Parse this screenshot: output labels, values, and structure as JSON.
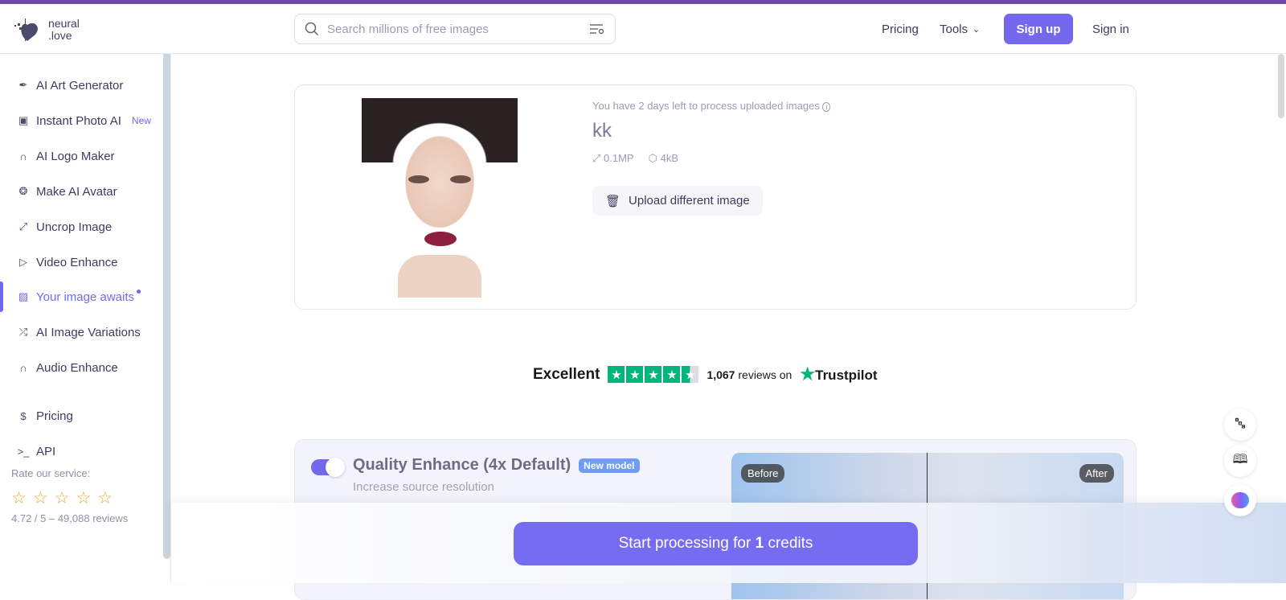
{
  "header": {
    "logo_line1": "neural",
    "logo_line2": ".love",
    "search_placeholder": "Search millions of free images",
    "nav_pricing": "Pricing",
    "nav_tools": "Tools",
    "signup": "Sign up",
    "signin": "Sign in"
  },
  "sidebar": {
    "items": [
      {
        "label": "AI Art Generator",
        "icon": "feather-icon"
      },
      {
        "label": "Instant Photo AI",
        "icon": "camera-icon",
        "badge": "New"
      },
      {
        "label": "AI Logo Maker",
        "icon": "rainbow-icon"
      },
      {
        "label": "Make AI Avatar",
        "icon": "aperture-icon"
      },
      {
        "label": "Uncrop Image",
        "icon": "expand-icon"
      },
      {
        "label": "Video Enhance",
        "icon": "play-icon"
      },
      {
        "label": "Your image awaits",
        "icon": "image-icon",
        "active": true
      },
      {
        "label": "AI Image Variations",
        "icon": "shuffle-icon"
      },
      {
        "label": "Audio Enhance",
        "icon": "headphones-icon"
      },
      {
        "label": "Pricing",
        "icon": "dollar-icon"
      },
      {
        "label": "API",
        "icon": "terminal-icon"
      }
    ],
    "rate_label": "Rate our service:",
    "rating_summary": "4.72 / 5 – 49,088 reviews"
  },
  "upload_card": {
    "notice": "You have 2 days left to process uploaded images",
    "file_name": "kk",
    "resolution": "0.1MP",
    "size": "4kB",
    "upload_button": "Upload different image"
  },
  "trustpilot": {
    "rating_word": "Excellent",
    "stars": 4.5,
    "review_count": "1,067",
    "reviews_on": "reviews on",
    "brand": "Trustpilot",
    "color": "#00b67a"
  },
  "enhance": {
    "title": "Quality Enhance (4x Default)",
    "badge": "New model",
    "subtitle": "Increase source resolution",
    "enabled": true,
    "before": "Before",
    "after": "After"
  },
  "action": {
    "start_prefix": "Start processing for ",
    "credits": "1",
    "start_suffix": " credits"
  },
  "colors": {
    "accent": "#7467f0",
    "topbar": "#6e47a8"
  }
}
